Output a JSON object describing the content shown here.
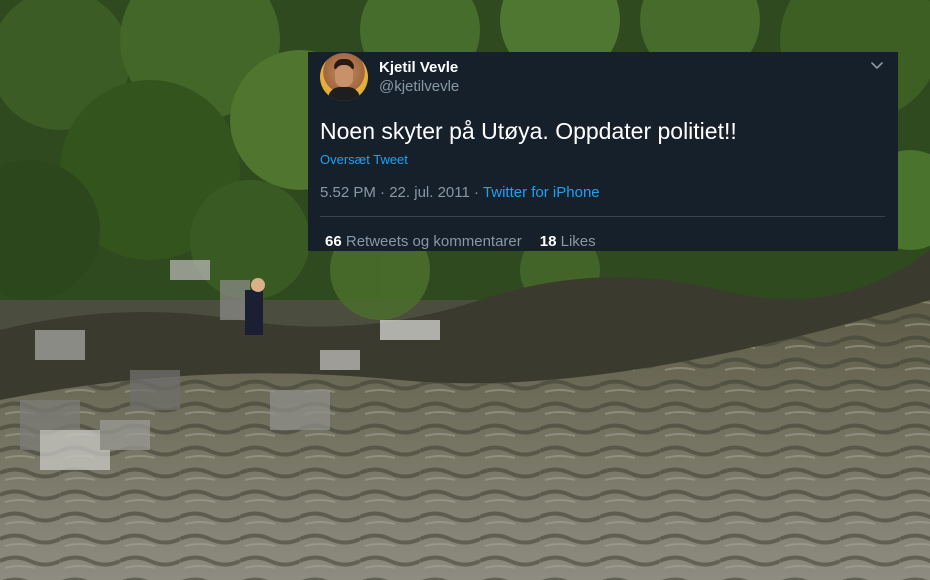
{
  "tweet": {
    "display_name": "Kjetil Vevle",
    "handle": "@kjetilvevle",
    "text": "Noen skyter på Utøya. Oppdater politiet!!",
    "translate_label": "Oversæt Tweet",
    "time": "5.52 PM",
    "separator": "·",
    "date": "22. jul. 2011",
    "source": "Twitter for iPhone",
    "retweets_count": "66",
    "retweets_label": "Retweets og kommentarer",
    "likes_count": "18",
    "likes_label": "Likes"
  },
  "icons": {
    "menu": "chevron-down-icon",
    "avatar": "profile-avatar"
  },
  "colors": {
    "card_background": "#15202b",
    "primary_text": "#ffffff",
    "secondary_text": "#8899a6",
    "link": "#1da1f2",
    "divider": "#38444d"
  }
}
